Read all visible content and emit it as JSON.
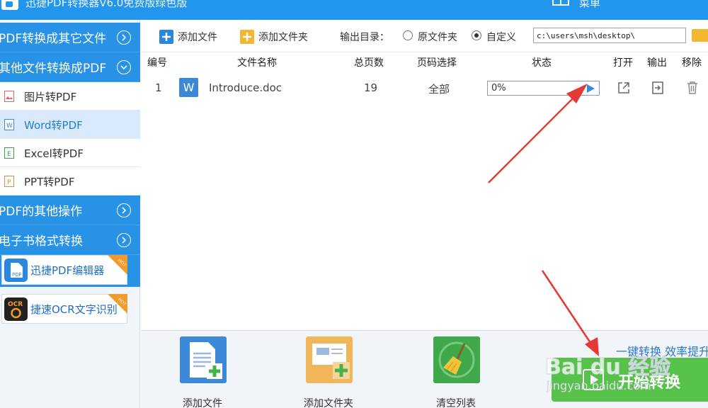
{
  "titlebar": {
    "title": "迅捷PDF转换器V6.0免费版绿色版",
    "menu_label": "菜单"
  },
  "sidebar": {
    "categories": [
      {
        "label": "PDF转换成其它文件"
      },
      {
        "label": "其他文件转换成PDF"
      },
      {
        "label": "PDF的其他操作"
      },
      {
        "label": "电子书格式转换"
      }
    ],
    "sub_items": [
      {
        "label": "图片转PDF",
        "icon": "image-file-icon"
      },
      {
        "label": "Word转PDF",
        "icon": "word-file-icon"
      },
      {
        "label": "Excel转PDF",
        "icon": "excel-file-icon"
      },
      {
        "label": "PPT转PDF",
        "icon": "ppt-file-icon"
      }
    ],
    "promos": [
      {
        "label": "迅捷PDF编辑器",
        "badge": "HOT"
      },
      {
        "label": "捷速OCR文字识别",
        "badge": "HOT"
      }
    ]
  },
  "toolbar": {
    "add_file": "添加文件",
    "add_folder": "添加文件夹",
    "output_dir_label": "输出目录：",
    "radio_original": "原文件夹",
    "radio_custom": "自定义",
    "selected": "自定义",
    "path_value": "c:\\users\\msh\\desktop\\"
  },
  "table": {
    "headers": [
      "编号",
      "文件名称",
      "总页数",
      "页码选择",
      "状态",
      "打开",
      "输出",
      "移除"
    ],
    "rows": [
      {
        "index": "1",
        "file_name": "Introduce.doc",
        "pages": "19",
        "page_select": "全部",
        "status_text": "0%",
        "progress": 0
      }
    ]
  },
  "bottom": {
    "add_file": "添加文件",
    "add_folder": "添加文件夹",
    "clear_list": "清空列表",
    "promo_text": "一键转换  效率提升",
    "start_label": "开始转换"
  },
  "watermark": {
    "brand": "Bai du 经验",
    "url": "jingyan.baidu.com"
  },
  "colors": {
    "primary": "#2893e6",
    "start": "#57c24a",
    "annotation": "#e53935"
  }
}
